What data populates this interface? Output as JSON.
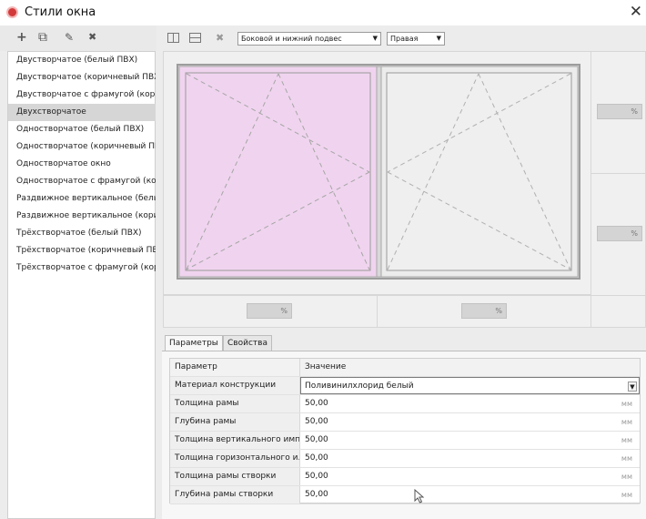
{
  "window": {
    "title": "Стили окна",
    "close_glyph": "✕",
    "icon": "app-window-icon"
  },
  "left_toolbar": {
    "buttons": [
      {
        "name": "add-icon",
        "glyph": "+"
      },
      {
        "name": "copy-icon",
        "glyph": "⧉"
      },
      {
        "name": "edit-icon",
        "glyph": "✎"
      },
      {
        "name": "delete-icon",
        "glyph": "✖"
      }
    ]
  },
  "styles_list": {
    "items": [
      "Двустворчатое (белый ПВХ)",
      "Двустворчатое (коричневый ПВХ)",
      "Двустворчатое с фрамугой (коричн",
      "Двухстворчатое",
      "Одностворчатое (белый ПВХ)",
      "Одностворчатое (коричневый ПВХ",
      "Одностворчатое окно",
      "Одностворчатое с фрамугой (кори",
      "Раздвижное вертикальное (белый",
      "Раздвижное вертикальное (коричн",
      "Трёхстворчатое (белый ПВХ)",
      "Трёхстворчатое (коричневый ПВХ",
      "Трёхстворчатое с фрамугой (кори"
    ],
    "selected_index": 3
  },
  "right_toolbar": {
    "split_vertical_icon": "split-vertical-icon",
    "split_horizontal_icon": "split-horizontal-icon",
    "remove_icon": "remove-split-icon",
    "opening_type": "Боковой и нижний подвес",
    "hinge_side": "Правая",
    "dropdown_arrow": "▼"
  },
  "preview": {
    "percent_unit": "%",
    "colors": {
      "selected_sash": "#f0d4ef",
      "sash": "#ececec",
      "frame": "#9d9d9d"
    }
  },
  "tabs": [
    {
      "label": "Параметры",
      "active": true
    },
    {
      "label": "Свойства",
      "active": false
    }
  ],
  "properties": {
    "header": {
      "param": "Параметр",
      "value": "Значение"
    },
    "rows": [
      {
        "param": "Материал конструкции",
        "value": "Поливинилхлорид белый",
        "unit": "",
        "dropdown": true
      },
      {
        "param": "Толщина рамы",
        "value": "50,00",
        "unit": "мм"
      },
      {
        "param": "Глубина рамы",
        "value": "50,00",
        "unit": "мм"
      },
      {
        "param": "Толщина вертикального имп...",
        "value": "50,00",
        "unit": "мм"
      },
      {
        "param": "Толщина горизонтального и...",
        "value": "50,00",
        "unit": "мм"
      },
      {
        "param": "Толщина рамы створки",
        "value": "50,00",
        "unit": "мм"
      },
      {
        "param": "Глубина рамы створки",
        "value": "50,00",
        "unit": "мм"
      }
    ]
  }
}
